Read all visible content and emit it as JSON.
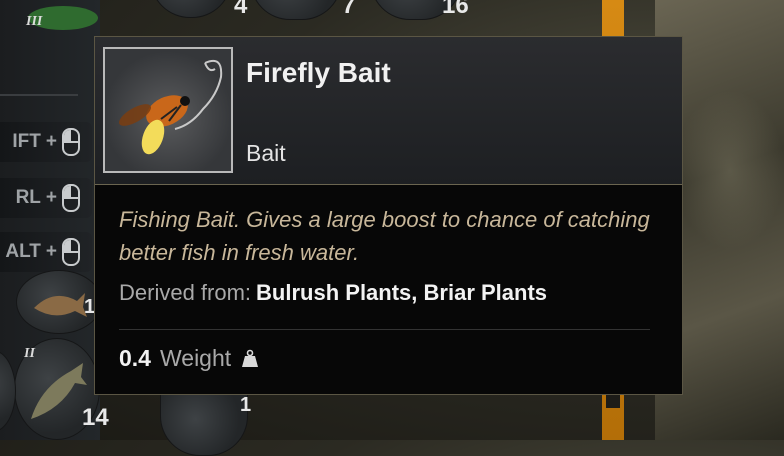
{
  "inventory": {
    "top_counts": [
      "4",
      "7",
      "16"
    ],
    "tier_labels": [
      "III",
      "II"
    ],
    "shortcuts": [
      {
        "key": "IFT",
        "plus": "+"
      },
      {
        "key": "RL",
        "plus": "+"
      },
      {
        "key": "ALT",
        "plus": "+"
      }
    ],
    "bottom_counts": [
      "14",
      "1"
    ],
    "side_count": "1"
  },
  "tooltip": {
    "title": "Firefly Bait",
    "subtitle": "Bait",
    "description": "Fishing Bait. Gives a large boost to chance of catching better fish in fresh water.",
    "derived_label": "Derived from:",
    "derived_value": "Bulrush Plants, Briar Plants",
    "weight_value": "0.4",
    "weight_label": "Weight",
    "weight_icon": "weight-icon"
  },
  "colors": {
    "description_text": "#c8b79a",
    "accent_bar": "#d68a14",
    "tooltip_bg": "#070707"
  }
}
